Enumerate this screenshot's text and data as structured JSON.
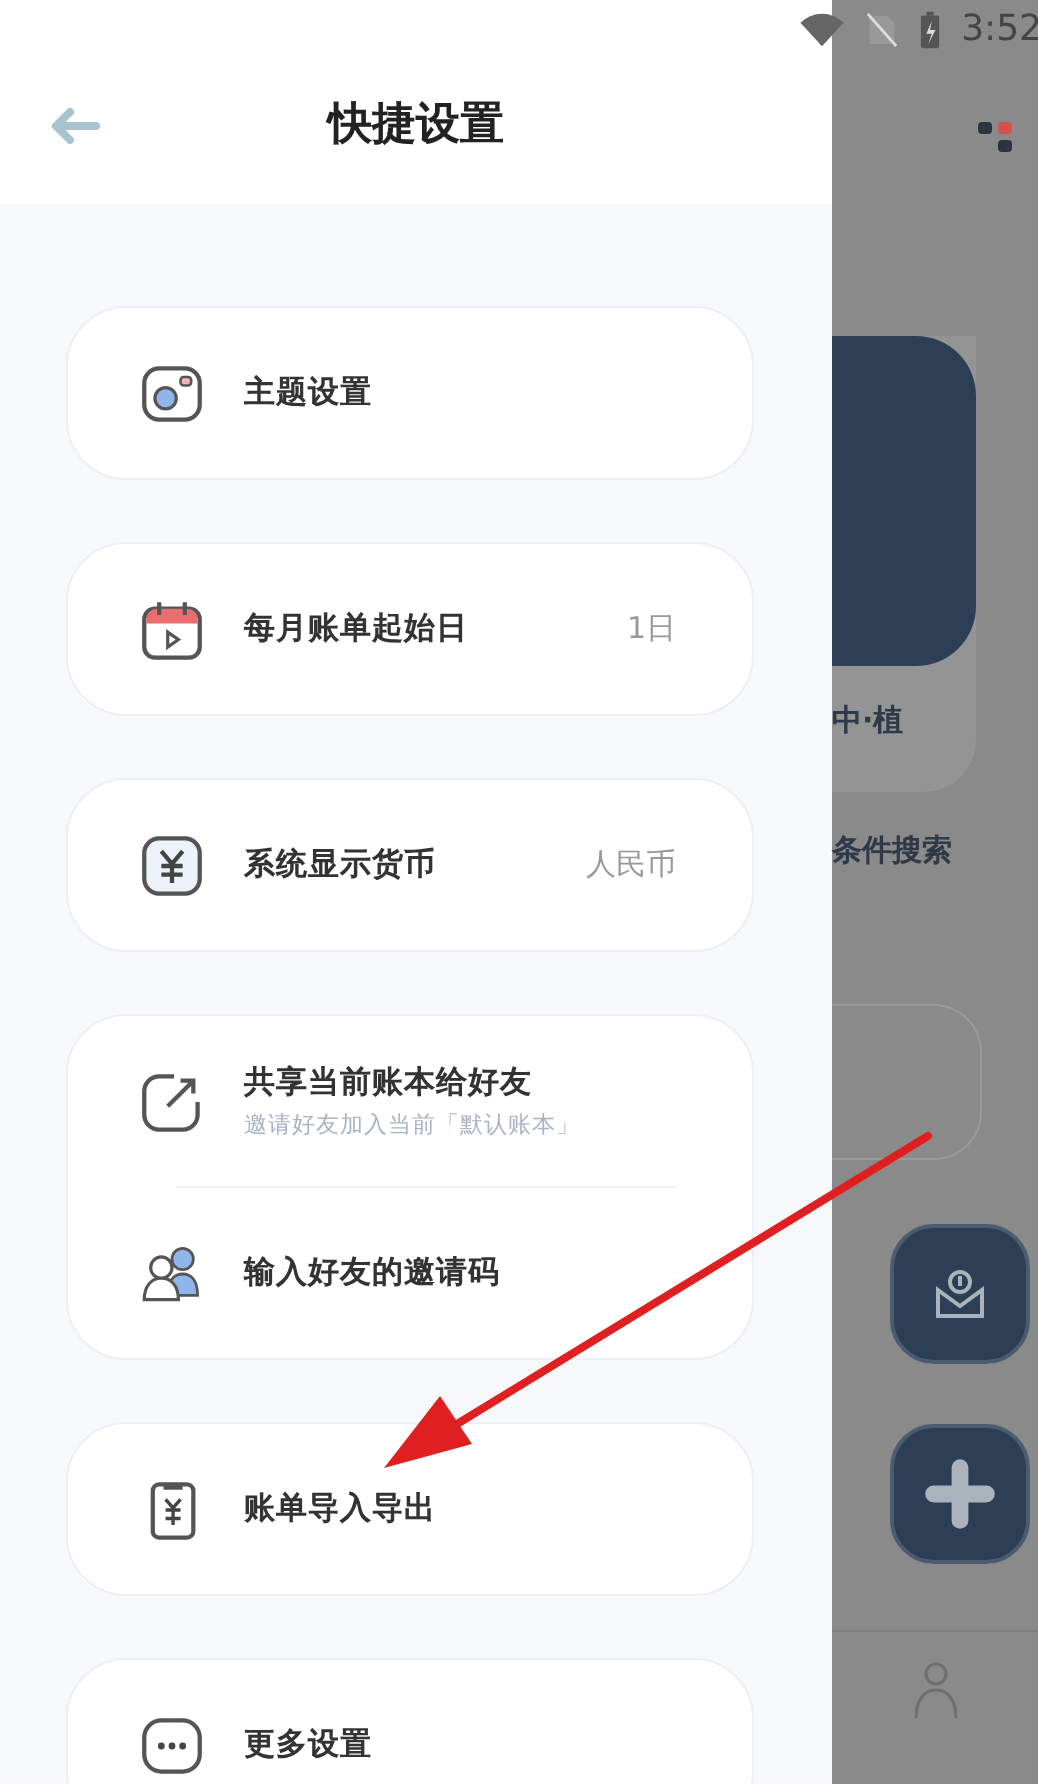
{
  "status_bar": {
    "time": "3:52"
  },
  "drawer": {
    "title": "快捷设置",
    "groups": [
      {
        "items": [
          {
            "label": "主题设置"
          }
        ]
      },
      {
        "items": [
          {
            "label": "每月账单起始日",
            "value": "1日"
          }
        ]
      },
      {
        "items": [
          {
            "label": "系统显示货币",
            "value": "人民币"
          }
        ]
      },
      {
        "items": [
          {
            "label": "共享当前账本给好友",
            "subtitle": "邀请好友加入当前「默认账本」"
          },
          {
            "label": "输入好友的邀请码"
          }
        ]
      },
      {
        "items": [
          {
            "label": "账单导入导出"
          }
        ]
      },
      {
        "items": [
          {
            "label": "更多设置"
          }
        ]
      }
    ]
  },
  "background": {
    "card_label": "中·植",
    "link": "条件搜索"
  }
}
